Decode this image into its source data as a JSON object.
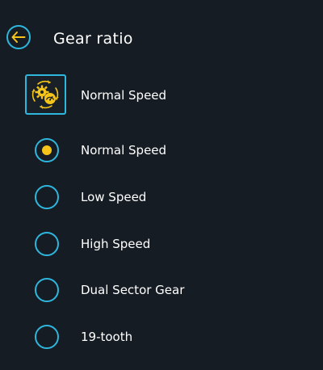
{
  "header": {
    "title": "Gear ratio",
    "back_icon": "arrow-left-icon"
  },
  "current": {
    "icon": "gear-ratio-icon",
    "label": "Normal Speed"
  },
  "colors": {
    "background": "#161c24",
    "accent": "#2fb6dd",
    "highlight": "#f4c518",
    "text": "#ffffff"
  },
  "options": [
    {
      "label": "Normal Speed",
      "selected": true
    },
    {
      "label": "Low Speed",
      "selected": false
    },
    {
      "label": "High Speed",
      "selected": false
    },
    {
      "label": "Dual Sector Gear",
      "selected": false
    },
    {
      "label": "19-tooth",
      "selected": false
    }
  ]
}
